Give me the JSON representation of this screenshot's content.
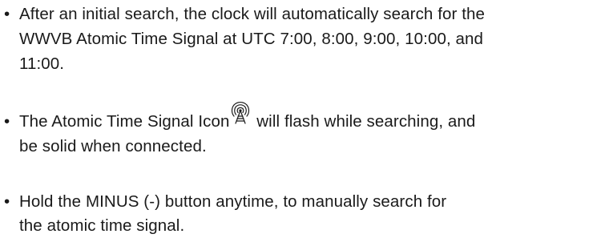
{
  "bullet_char": "•",
  "items": [
    {
      "lines": [
        "After an initial search, the clock will automatically search for the",
        "WWVB Atomic Time Signal at UTC 7:00, 8:00, 9:00, 10:00, and",
        "11:00."
      ]
    },
    {
      "before_icon": "The Atomic Time Signal Icon",
      "icon": "atomic-signal-icon",
      "after_icon": " will flash while searching, and",
      "line2": "be solid when connected."
    },
    {
      "lines": [
        "Hold the MINUS (-) button anytime, to manually search for",
        "the atomic time signal."
      ]
    }
  ]
}
